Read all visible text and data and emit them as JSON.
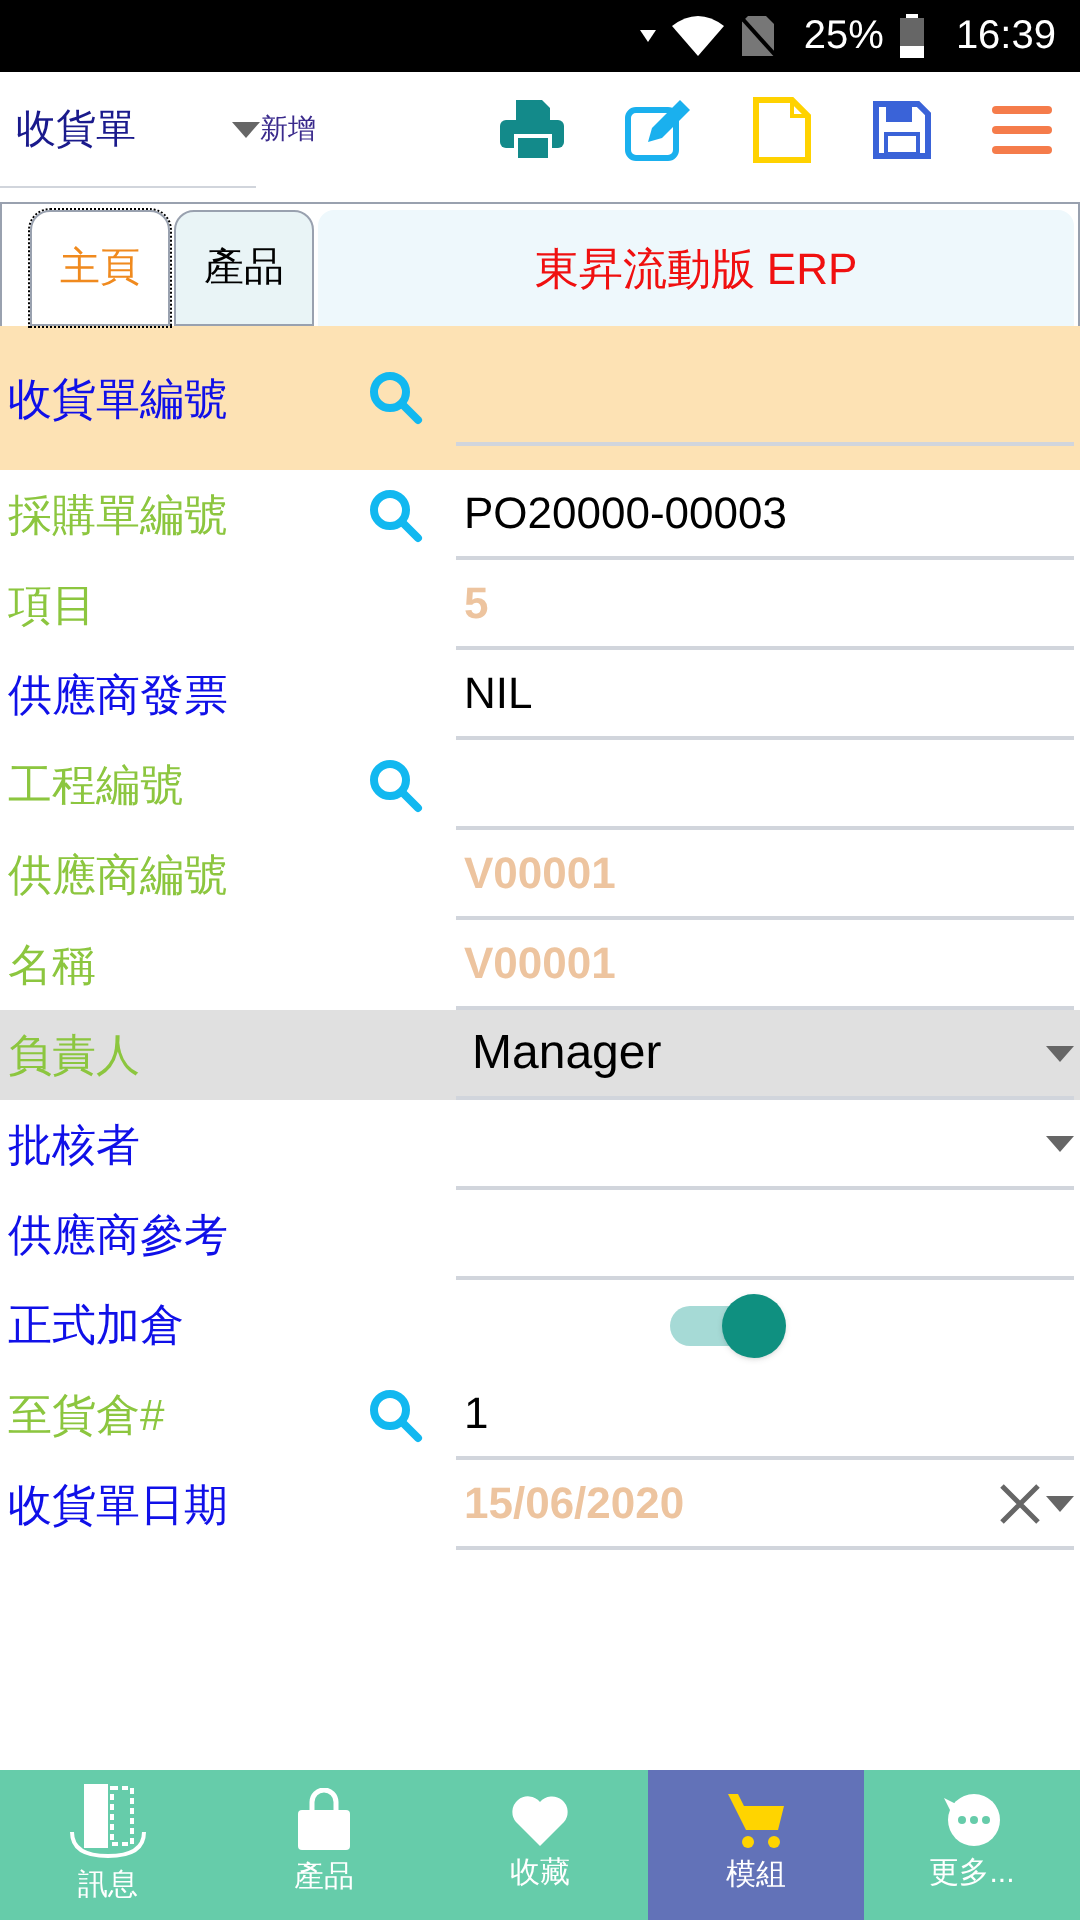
{
  "status_bar": {
    "battery": "25%",
    "time": "16:39"
  },
  "header": {
    "title": "收貨單",
    "mode": "新增"
  },
  "tabs": [
    {
      "label": "主頁",
      "selected": true
    },
    {
      "label": "產品",
      "selected": false
    }
  ],
  "banner": "東昇流動版 ERP",
  "fields": [
    {
      "label": "收貨單編號",
      "color": "#1010e8",
      "search": true,
      "kind": "text",
      "selected": true,
      "focused": false
    },
    {
      "label": "採購單編號",
      "color": "#8cc63f",
      "search": true,
      "kind": "text",
      "value": "PO20000-00003",
      "readonly": false,
      "selected": false,
      "focused": false
    },
    {
      "label": "項目",
      "color": "#8cc63f",
      "search": false,
      "kind": "text",
      "value": "5",
      "readonly": true,
      "selected": false,
      "focused": false
    },
    {
      "label": "供應商發票",
      "color": "#1010e8",
      "search": false,
      "kind": "text",
      "value": "NIL",
      "readonly": false,
      "selected": false,
      "focused": false
    },
    {
      "label": "工程編號",
      "color": "#8cc63f",
      "search": true,
      "kind": "text",
      "selected": false,
      "focused": false
    },
    {
      "label": "供應商編號",
      "color": "#8cc63f",
      "search": false,
      "kind": "text",
      "value": "V00001",
      "readonly": true,
      "selected": false,
      "focused": false
    },
    {
      "label": "名稱",
      "color": "#8cc63f",
      "search": false,
      "kind": "text",
      "value": "V00001",
      "readonly": true,
      "selected": false,
      "focused": false
    },
    {
      "label": "負責人",
      "color": "#8cc63f",
      "search": false,
      "kind": "select",
      "value": "Manager",
      "readonly": false,
      "selected": false,
      "focused": true
    },
    {
      "label": "批核者",
      "color": "#1010e8",
      "search": false,
      "kind": "select",
      "selected": false,
      "focused": false
    },
    {
      "label": "供應商參考",
      "color": "#1010e8",
      "search": false,
      "kind": "text",
      "selected": false,
      "focused": false
    },
    {
      "label": "正式加倉",
      "color": "#1010e8",
      "search": false,
      "kind": "toggle",
      "on": true,
      "selected": false,
      "focused": false
    },
    {
      "label": "至貨倉#",
      "color": "#8cc63f",
      "search": true,
      "kind": "text",
      "value": "1",
      "readonly": false,
      "selected": false,
      "focused": false
    },
    {
      "label": "收貨單日期",
      "color": "#1010e8",
      "search": false,
      "kind": "date",
      "value": "15/06/2020",
      "readonly": true,
      "selected": false,
      "focused": false
    }
  ],
  "bottom_nav": [
    {
      "label": "訊息",
      "selected": false
    },
    {
      "label": "產品",
      "selected": false
    },
    {
      "label": "收藏",
      "selected": false
    },
    {
      "label": "模組",
      "selected": true
    },
    {
      "label": "更多...",
      "selected": false
    }
  ]
}
